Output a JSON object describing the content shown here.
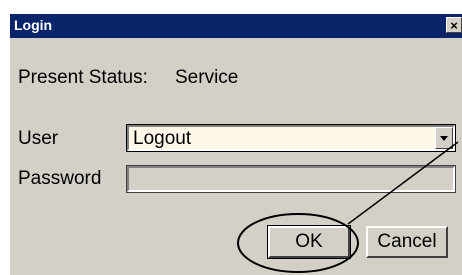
{
  "dialog": {
    "title": "Login",
    "close_glyph": "×",
    "close_icon": "close-icon"
  },
  "status": {
    "label": "Present Status:",
    "value": "Service"
  },
  "user": {
    "label": "User",
    "selected": "Logout",
    "dropdown_icon": "chevron-down-icon"
  },
  "password": {
    "label": "Password",
    "value": ""
  },
  "buttons": {
    "ok": "OK",
    "cancel": "Cancel"
  },
  "colors": {
    "titlebar": "#0a246a",
    "dialog_bg": "#d4d0c8",
    "combo_bg": "#fff8e8"
  }
}
